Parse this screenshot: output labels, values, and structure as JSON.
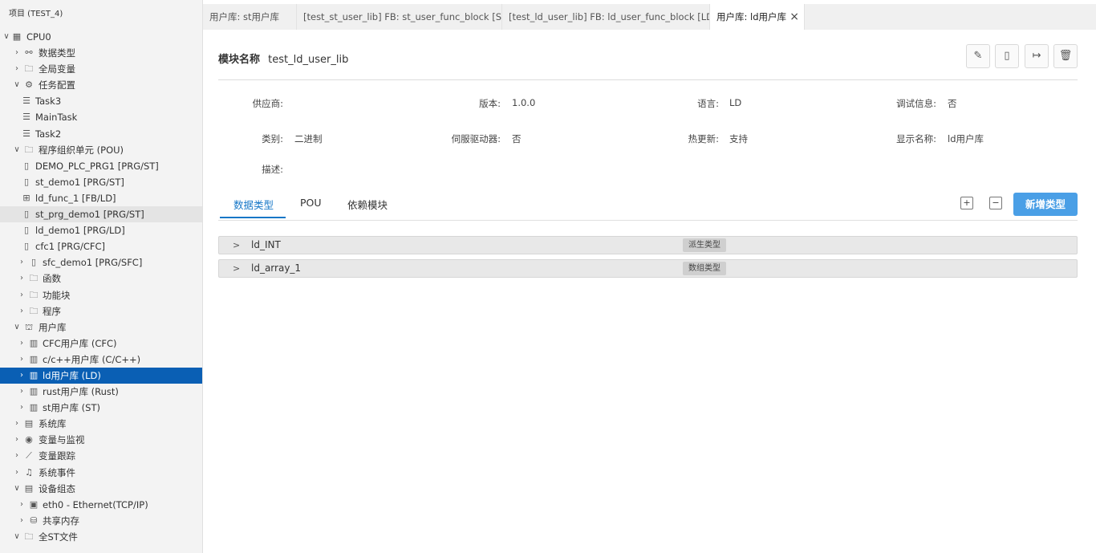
{
  "sidebar": {
    "project_title": "项目 (TEST_4)",
    "tree": [
      {
        "label": "CPU0",
        "indent": 0,
        "chev": "v",
        "icon": "cpu-icon",
        "glyph": "▦"
      },
      {
        "label": "数据类型",
        "indent": 1,
        "chev": ">",
        "icon": "datatype-icon",
        "glyph": "⚯"
      },
      {
        "label": "全局变量",
        "indent": 1,
        "chev": ">",
        "icon": "folder-icon",
        "glyph": "🗀"
      },
      {
        "label": "任务配置",
        "indent": 1,
        "chev": "v",
        "icon": "gear-icon",
        "glyph": "⚙"
      },
      {
        "label": "Task3",
        "indent": 2,
        "chev": "",
        "icon": "task-list-icon",
        "glyph": "☰"
      },
      {
        "label": "MainTask",
        "indent": 2,
        "chev": "",
        "icon": "task-list-icon",
        "glyph": "☰"
      },
      {
        "label": "Task2",
        "indent": 2,
        "chev": "",
        "icon": "task-list-icon",
        "glyph": "☰"
      },
      {
        "label": "程序组织单元 (POU)",
        "indent": 1,
        "chev": "v",
        "icon": "folder-icon",
        "glyph": "🗀"
      },
      {
        "label": "DEMO_PLC_PRG1 [PRG/ST]",
        "indent": 2,
        "chev": "",
        "icon": "program-file-icon",
        "glyph": "▯"
      },
      {
        "label": "st_demo1 [PRG/ST]",
        "indent": 2,
        "chev": "",
        "icon": "program-file-icon",
        "glyph": "▯"
      },
      {
        "label": "ld_func_1 [FB/LD]",
        "indent": 2,
        "chev": "",
        "icon": "function-block-icon",
        "glyph": "⊞"
      },
      {
        "label": "st_prg_demo1 [PRG/ST]",
        "indent": 2,
        "chev": "",
        "icon": "program-file-icon",
        "glyph": "▯",
        "state": "hover"
      },
      {
        "label": "ld_demo1 [PRG/LD]",
        "indent": 2,
        "chev": "",
        "icon": "program-file-icon",
        "glyph": "▯"
      },
      {
        "label": "cfc1 [PRG/CFC]",
        "indent": 2,
        "chev": "",
        "icon": "program-file-icon",
        "glyph": "▯"
      },
      {
        "label": "sfc_demo1 [PRG/SFC]",
        "indent": 2,
        "chev": ">",
        "icon": "program-file-icon",
        "glyph": "▯"
      },
      {
        "label": "函数",
        "indent": 2,
        "chev": ">",
        "icon": "folder-icon",
        "glyph": "🗀"
      },
      {
        "label": "功能块",
        "indent": 2,
        "chev": ">",
        "icon": "folder-icon",
        "glyph": "🗀"
      },
      {
        "label": "程序",
        "indent": 2,
        "chev": ">",
        "icon": "folder-icon",
        "glyph": "🗀"
      },
      {
        "label": "用户库",
        "indent": 1,
        "chev": "v",
        "icon": "library-icon",
        "glyph": "⛫"
      },
      {
        "label": "CFC用户库 (CFC)",
        "indent": 2,
        "chev": ">",
        "icon": "book-icon",
        "glyph": "▥"
      },
      {
        "label": "c/c++用户库 (C/C++)",
        "indent": 2,
        "chev": ">",
        "icon": "book-icon",
        "glyph": "▥"
      },
      {
        "label": "ld用户库 (LD)",
        "indent": 2,
        "chev": ">",
        "icon": "book-icon",
        "glyph": "▥",
        "state": "selected"
      },
      {
        "label": "rust用户库 (Rust)",
        "indent": 2,
        "chev": ">",
        "icon": "book-icon",
        "glyph": "▥"
      },
      {
        "label": "st用户库 (ST)",
        "indent": 2,
        "chev": ">",
        "icon": "book-icon",
        "glyph": "▥"
      },
      {
        "label": "系统库",
        "indent": 1,
        "chev": ">",
        "icon": "archive-icon",
        "glyph": "▤"
      },
      {
        "label": "变量与监视",
        "indent": 1,
        "chev": ">",
        "icon": "eye-icon",
        "glyph": "◉"
      },
      {
        "label": "变量跟踪",
        "indent": 1,
        "chev": ">",
        "icon": "chart-line-icon",
        "glyph": "⟋"
      },
      {
        "label": "系统事件",
        "indent": 1,
        "chev": ">",
        "icon": "bell-icon",
        "glyph": "♫"
      },
      {
        "label": "设备组态",
        "indent": 1,
        "chev": "v",
        "icon": "device-icon",
        "glyph": "▤"
      },
      {
        "label": "eth0 - Ethernet(TCP/IP)",
        "indent": 2,
        "chev": ">",
        "icon": "ethernet-icon",
        "glyph": "▣"
      },
      {
        "label": "共享内存",
        "indent": 2,
        "chev": ">",
        "icon": "database-icon",
        "glyph": "⛁"
      },
      {
        "label": "全ST文件",
        "indent": 1,
        "chev": "v",
        "icon": "folder-icon",
        "glyph": "🗀"
      }
    ]
  },
  "tabs": [
    {
      "label": "用户库: st用户库",
      "active": false
    },
    {
      "label": "[test_st_user_lib] FB: st_user_func_block [ST]",
      "active": false
    },
    {
      "label": "[test_ld_user_lib] FB: ld_user_func_block [LD]",
      "active": false
    },
    {
      "label": "用户库: ld用户库",
      "active": true
    }
  ],
  "main": {
    "module_name_label": "模块名称",
    "module_name_value": "test_ld_user_lib",
    "actions": [
      {
        "name": "edit-button",
        "icon": "pencil-icon",
        "glyph": "✎"
      },
      {
        "name": "file-button",
        "icon": "file-icon",
        "glyph": "▯"
      },
      {
        "name": "export-button",
        "icon": "export-icon",
        "glyph": "↦"
      },
      {
        "name": "delete-button",
        "icon": "trash-icon",
        "glyph": "🗑"
      }
    ],
    "info": {
      "vendor_label": "供应商:",
      "vendor_value": "",
      "version_label": "版本:",
      "version_value": "1.0.0",
      "language_label": "语言:",
      "language_value": "LD",
      "debug_label": "调试信息:",
      "debug_value": "否",
      "category_label": "类别:",
      "category_value": "二进制",
      "servo_label": "伺服驱动器:",
      "servo_value": "否",
      "hotupdate_label": "热更新:",
      "hotupdate_value": "支持",
      "display_label": "显示名称:",
      "display_value": "ld用户库",
      "desc_label": "描述:",
      "desc_value": ""
    },
    "subtabs": [
      "数据类型",
      "POU",
      "依赖模块"
    ],
    "add_type_button": "新增类型",
    "types": [
      {
        "name": "ld_INT",
        "badge": "派生类型"
      },
      {
        "name": "ld_array_1",
        "badge": "数组类型"
      }
    ]
  },
  "colors": {
    "accent": "#1677c7",
    "selected_bg": "#0a5fb4",
    "primary_button": "#4a9fe6"
  }
}
